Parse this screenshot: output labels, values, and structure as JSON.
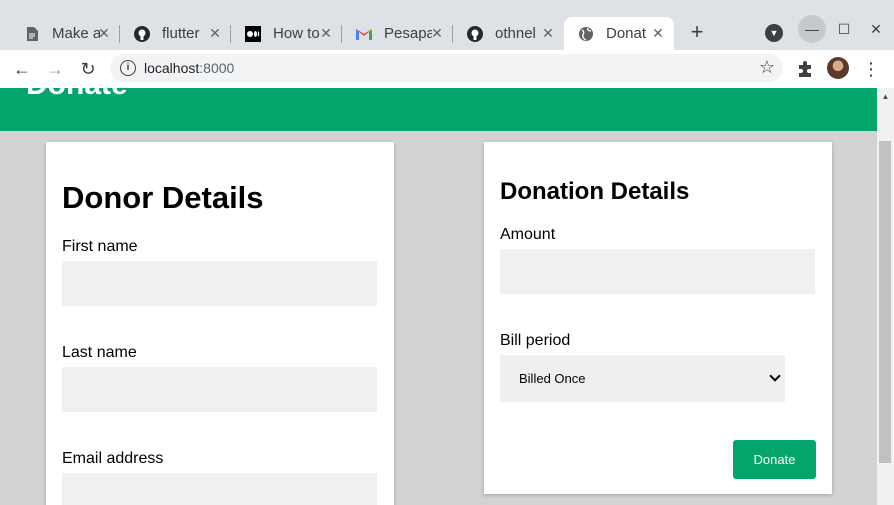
{
  "browser": {
    "tabs": [
      {
        "title": "Make a",
        "icon": "document-icon",
        "active": false
      },
      {
        "title": "flutter",
        "icon": "github-icon",
        "active": false
      },
      {
        "title": "How to",
        "icon": "medium-icon",
        "active": false
      },
      {
        "title": "Pesapa",
        "icon": "gmail-icon",
        "active": false
      },
      {
        "title": "othnel",
        "icon": "github-icon",
        "active": false
      },
      {
        "title": "Donat",
        "icon": "globe-icon",
        "active": true
      }
    ],
    "url_host": "localhost",
    "url_port": ":8000"
  },
  "page": {
    "header_title": "Donate",
    "donor": {
      "heading": "Donor Details",
      "first_name_label": "First name",
      "last_name_label": "Last name",
      "email_label": "Email address",
      "first_name_value": "",
      "last_name_value": "",
      "email_value": ""
    },
    "donation": {
      "heading": "Donation Details",
      "amount_label": "Amount",
      "amount_value": "",
      "bill_period_label": "Bill period",
      "bill_period_value": "Billed Once",
      "donate_label": "Donate"
    }
  },
  "colors": {
    "accent": "#04a56b",
    "page_background": "#d3d3d3",
    "input_background": "#f0f0f0"
  }
}
